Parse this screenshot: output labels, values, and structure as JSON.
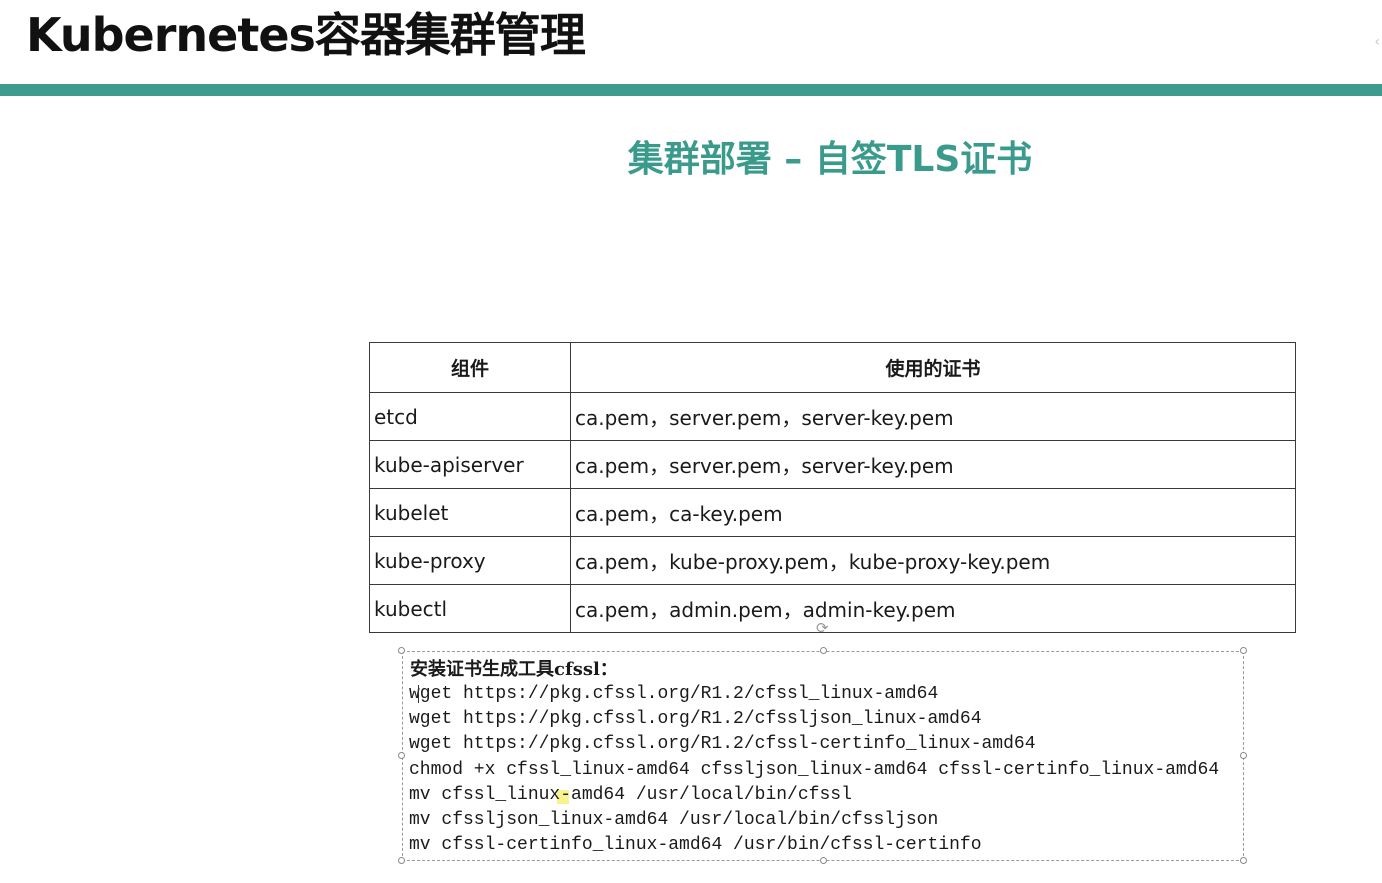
{
  "header": {
    "title": "Kubernetes容器集群管理",
    "accent_color": "#3d9c8e"
  },
  "slide": {
    "title": "集群部署 – 自签TLS证书",
    "title_color": "#3a9a8c"
  },
  "table": {
    "headers": [
      "组件",
      "使用的证书"
    ],
    "rows": [
      {
        "component": "etcd",
        "certs": "ca.pem，server.pem，server-key.pem"
      },
      {
        "component": "kube-apiserver",
        "certs": "ca.pem，server.pem，server-key.pem"
      },
      {
        "component": "kubelet",
        "certs": "ca.pem，ca-key.pem"
      },
      {
        "component": "kube-proxy",
        "certs": "ca.pem，kube-proxy.pem，kube-proxy-key.pem"
      },
      {
        "component": "kubectl",
        "certs": "ca.pem，admin.pem，admin-key.pem"
      }
    ]
  },
  "code_box": {
    "heading": "安装证书生成工具cfssl：",
    "lines": [
      "wget https://pkg.cfssl.org/R1.2/cfssl_linux-amd64",
      "wget https://pkg.cfssl.org/R1.2/cfssljson_linux-amd64",
      "wget https://pkg.cfssl.org/R1.2/cfssl-certinfo_linux-amd64",
      "chmod +x cfssl_linux-amd64 cfssljson_linux-amd64 cfssl-certinfo_linux-amd64",
      "mv cfssl_linux-amd64 /usr/local/bin/cfssl",
      "mv cfssljson_linux-amd64 /usr/local/bin/cfssljson",
      "mv cfssl-certinfo_linux-amd64 /usr/bin/cfssl-certinfo"
    ]
  },
  "icons": {
    "rotate": "rotate-handle-icon",
    "collapse": "chevron-left-icon"
  }
}
